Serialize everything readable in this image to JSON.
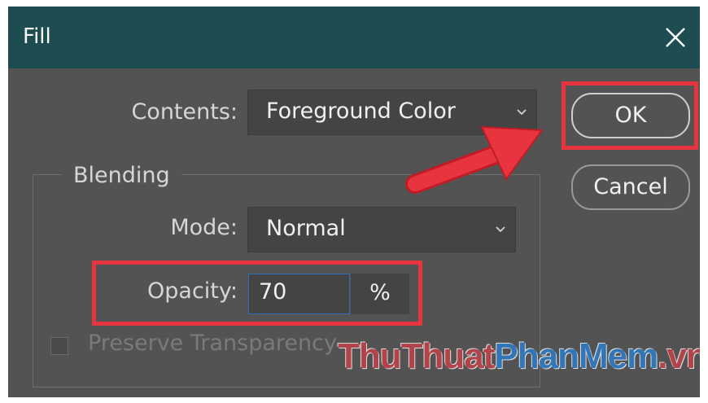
{
  "window": {
    "title": "Fill"
  },
  "contents": {
    "label": "Contents:",
    "value": "Foreground Color"
  },
  "blending": {
    "group_label": "Blending",
    "mode_label": "Mode:",
    "mode_value": "Normal",
    "opacity_label": "Opacity:",
    "opacity_value": "70",
    "opacity_unit": "%"
  },
  "preserve_transparency": {
    "label": "Preserve Transparency",
    "checked": false,
    "enabled": false
  },
  "buttons": {
    "ok": "OK",
    "cancel": "Cancel"
  },
  "watermark": {
    "part1": "ThuThuat",
    "part2": "PhanMem",
    "part3": ".vn"
  },
  "colors": {
    "titlebar": "#1d4c51",
    "dialog_bg": "#535353",
    "highlight": "#e8343f",
    "input_focus": "#2f6fb6"
  },
  "icons": {
    "close": "close-icon",
    "dropdown": "chevron-down-icon",
    "pointer": "arrow-pointer-icon"
  }
}
